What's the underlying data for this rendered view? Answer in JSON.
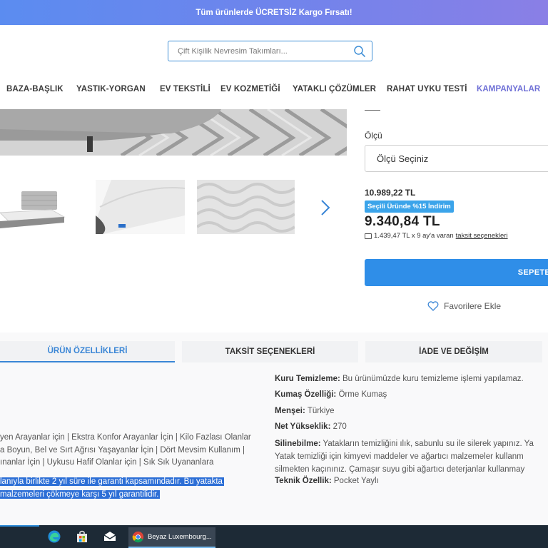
{
  "promo": {
    "text": "Tüm ürünlerde ÜCRETSİZ Kargo Fırsatı!"
  },
  "search": {
    "placeholder": "Çift Kişilik Nevresim Takımları..."
  },
  "nav": {
    "items": [
      {
        "label": "BAZA-BAŞLIK"
      },
      {
        "label": "YASTIK-YORGAN"
      },
      {
        "label": "EV TEKSTİLİ"
      },
      {
        "label": "EV KOZMETİĞİ"
      },
      {
        "label": "YATAKLI ÇÖZÜMLER"
      },
      {
        "label": "RAHAT UYKU TESTİ"
      },
      {
        "label": "KAMPANYALAR"
      }
    ]
  },
  "product": {
    "size_label": "Ölçü",
    "size_select": "Ölçü Seçiniz",
    "old_price": "10.989,22 TL",
    "discount_badge": "Seçili Üründe %15 İndirim",
    "new_price": "9.340,84 TL",
    "installment_text": "1.439,47 TL x 9 ay'a varan",
    "installment_link": "taksit seçenekleri",
    "add_to_cart": "SEPETE",
    "favorite": "Favorilere Ekle"
  },
  "tabs": [
    {
      "label": "ÜRÜN ÖZELLİKLERİ"
    },
    {
      "label": "TAKSİT SEÇENEKLERİ"
    },
    {
      "label": "İADE VE DEĞİŞİM"
    }
  ],
  "specs": {
    "dry_clean_label": "Kuru Temizleme:",
    "dry_clean_value": "Bu ürünümüzde kuru temizleme işlemi yapılamaz.",
    "fabric_label": "Kumaş Özelliği:",
    "fabric_value": "Örme Kumaş",
    "origin_label": "Menşei:",
    "origin_value": "Türkiye",
    "height_label": "Net Yükseklik:",
    "height_value": "270",
    "washable_label": "Silinebilme:",
    "washable_line1": "Yatakların temizliğini ılık, sabunlu su ile silerek yapınız. Ya",
    "washable_line2": "Yatak temizliği için kimyevi maddeler ve ağartıcı malzemeler kullanm",
    "washable_line3": "silmekten kaçınınız. Çamaşır suyu gibi ağartıcı deterjanlar kullanmay",
    "technical_label": "Teknik Özellik:",
    "technical_value": "Pocket Yaylı"
  },
  "description": {
    "line1": "yen Arayanlar için | Ekstra Konfor Arayanlar İçin | Kilo Fazlası Olanlar",
    "line2": "a Boyun, Bel ve Sırt Ağrısı Yaşayanlar İçin | Dört Mevsim Kullanım |",
    "line3": "ınanlar İçin | Uykusu Hafif Olanlar için | Sık Sık Uyananlara",
    "highlight1": "lanıyla birlikte 2 yıl süre ile garanti kapsamındadır. Bu yatakta",
    "highlight2": "malzemeleri çökmeye karşı 5 yıl garantilidir."
  },
  "taskbar": {
    "app_label": "Beyaz Luxembourg..."
  }
}
